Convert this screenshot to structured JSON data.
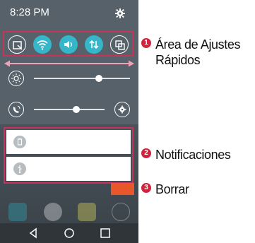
{
  "status_bar": {
    "time": "8:28 PM"
  },
  "quick_settings": {
    "toggles": [
      {
        "name": "screen-capture",
        "state": "off"
      },
      {
        "name": "wifi",
        "state": "on"
      },
      {
        "name": "sound",
        "state": "on"
      },
      {
        "name": "data",
        "state": "on"
      },
      {
        "name": "multi-window",
        "state": "off"
      }
    ],
    "brightness_level": 0.68,
    "volume_level": 0.6
  },
  "callouts": [
    {
      "number": "1",
      "line1": "Área de Ajustes",
      "line2": "Rápidos"
    },
    {
      "number": "2",
      "line1": "Notificaciones"
    },
    {
      "number": "3",
      "line1": "Borrar"
    }
  ],
  "colors": {
    "accent": "#35b7c9",
    "highlight": "#c8335a",
    "clear": "#e8572a",
    "badge": "#d2233c"
  }
}
